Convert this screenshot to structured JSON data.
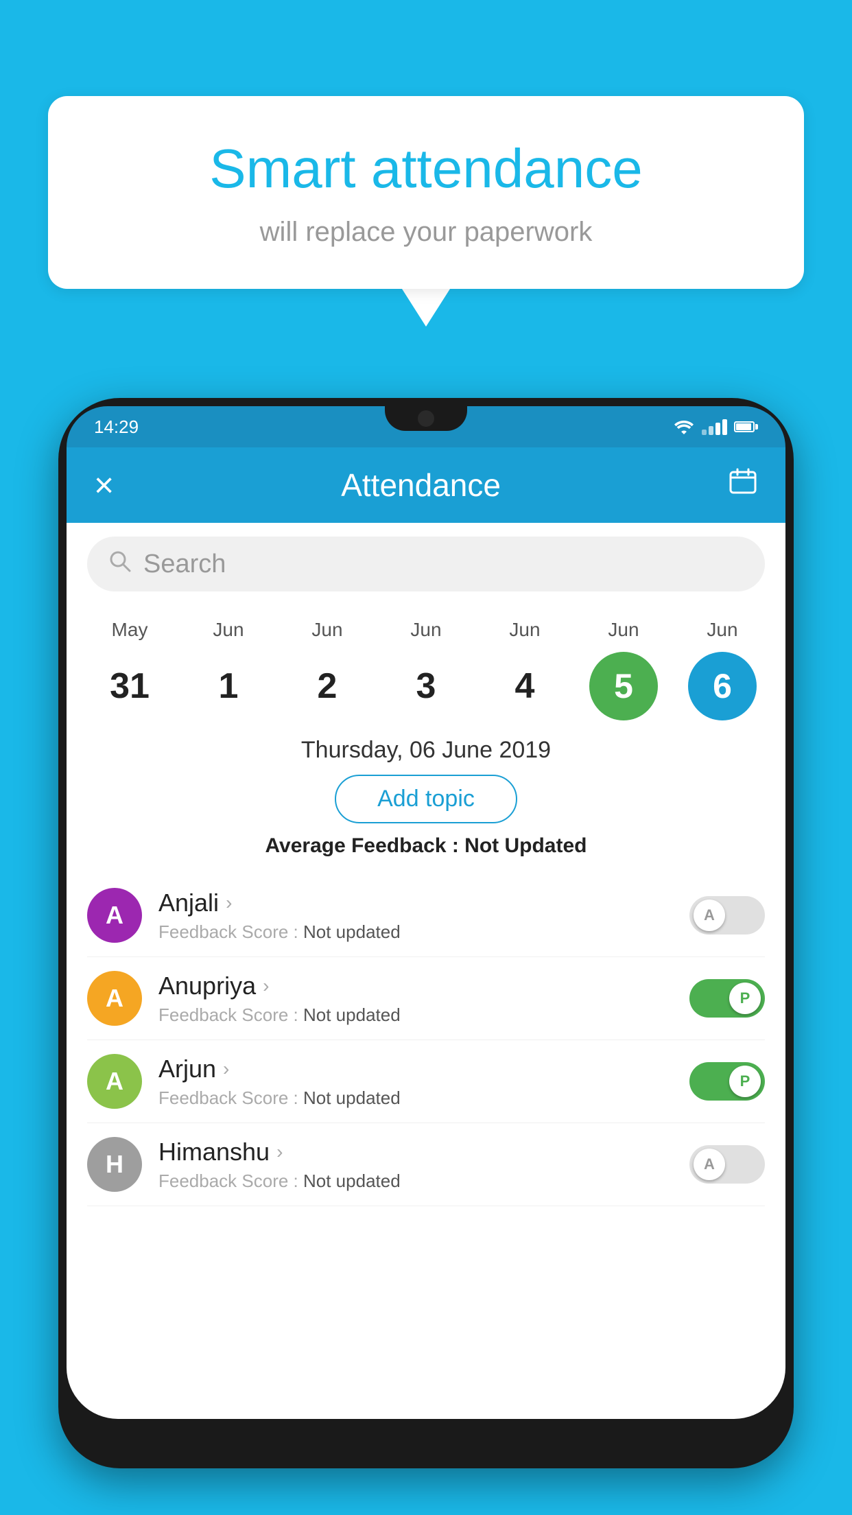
{
  "background_color": "#1ab8e8",
  "speech_bubble": {
    "title": "Smart attendance",
    "subtitle": "will replace your paperwork"
  },
  "status_bar": {
    "time": "14:29",
    "wifi": "wifi",
    "signal": "signal",
    "battery": "battery"
  },
  "app_header": {
    "close_label": "×",
    "title": "Attendance",
    "calendar_icon": "calendar"
  },
  "search": {
    "placeholder": "Search"
  },
  "dates": [
    {
      "month": "May",
      "day": "31",
      "highlight": "none"
    },
    {
      "month": "Jun",
      "day": "1",
      "highlight": "none"
    },
    {
      "month": "Jun",
      "day": "2",
      "highlight": "none"
    },
    {
      "month": "Jun",
      "day": "3",
      "highlight": "none"
    },
    {
      "month": "Jun",
      "day": "4",
      "highlight": "none"
    },
    {
      "month": "Jun",
      "day": "5",
      "highlight": "green"
    },
    {
      "month": "Jun",
      "day": "6",
      "highlight": "blue"
    }
  ],
  "selected_date": "Thursday, 06 June 2019",
  "add_topic_label": "Add topic",
  "avg_feedback": {
    "label": "Average Feedback : ",
    "value": "Not Updated"
  },
  "students": [
    {
      "name": "Anjali",
      "avatar_letter": "A",
      "avatar_color": "#9c27b0",
      "feedback_label": "Feedback Score : ",
      "feedback_value": "Not updated",
      "toggle": "off",
      "toggle_label": "A"
    },
    {
      "name": "Anupriya",
      "avatar_letter": "A",
      "avatar_color": "#f5a623",
      "feedback_label": "Feedback Score : ",
      "feedback_value": "Not updated",
      "toggle": "on",
      "toggle_label": "P"
    },
    {
      "name": "Arjun",
      "avatar_letter": "A",
      "avatar_color": "#8bc34a",
      "feedback_label": "Feedback Score : ",
      "feedback_value": "Not updated",
      "toggle": "on",
      "toggle_label": "P"
    },
    {
      "name": "Himanshu",
      "avatar_letter": "H",
      "avatar_color": "#9e9e9e",
      "feedback_label": "Feedback Score : ",
      "feedback_value": "Not updated",
      "toggle": "off",
      "toggle_label": "A"
    }
  ]
}
